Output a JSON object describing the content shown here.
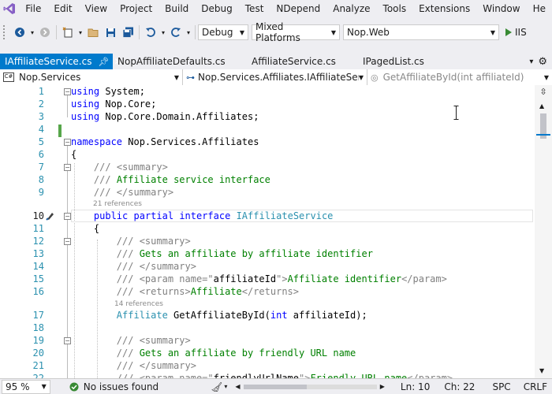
{
  "menu": {
    "items": [
      "File",
      "Edit",
      "View",
      "Project",
      "Build",
      "Debug",
      "Test",
      "NDepend",
      "Analyze",
      "Tools",
      "Extensions",
      "Window",
      "He"
    ]
  },
  "toolbar": {
    "config": "Debug",
    "platform": "Mixed Platforms",
    "startup_project": "Nop.Web",
    "run_label": "IIS"
  },
  "tabs": [
    {
      "label": "IAffiliateService.cs",
      "active": true
    },
    {
      "label": "NopAffiliateDefaults.cs",
      "active": false
    },
    {
      "label": "AffiliateService.cs",
      "active": false
    },
    {
      "label": "IPagedList.cs",
      "active": false
    }
  ],
  "nav": {
    "project": "Nop.Services",
    "type": "Nop.Services.Affiliates.IAffiliateServic",
    "member": "GetAffiliateById(int affiliateId)"
  },
  "code": {
    "lines": [
      {
        "n": "1",
        "text": "using System;"
      },
      {
        "n": "2",
        "text": "using Nop.Core;"
      },
      {
        "n": "3",
        "text": "using Nop.Core.Domain.Affiliates;"
      },
      {
        "n": "4",
        "text": ""
      },
      {
        "n": "5",
        "text": "namespace Nop.Services.Affiliates"
      },
      {
        "n": "6",
        "text": "{"
      },
      {
        "n": "7",
        "text": "    /// <summary>"
      },
      {
        "n": "8",
        "text": "    /// Affiliate service interface"
      },
      {
        "n": "9",
        "text": "    /// </summary>"
      },
      {
        "n": "10",
        "text": "    public partial interface IAffiliateService"
      },
      {
        "n": "11",
        "text": "    {"
      },
      {
        "n": "12",
        "text": "        /// <summary>"
      },
      {
        "n": "13",
        "text": "        /// Gets an affiliate by affiliate identifier"
      },
      {
        "n": "14",
        "text": "        /// </summary>"
      },
      {
        "n": "15",
        "text": "        /// <param name=\"affiliateId\">Affiliate identifier</param>"
      },
      {
        "n": "16",
        "text": "        /// <returns>Affiliate</returns>"
      },
      {
        "n": "17",
        "text": "        Affiliate GetAffiliateById(int affiliateId);"
      },
      {
        "n": "18",
        "text": ""
      },
      {
        "n": "19",
        "text": "        /// <summary>"
      },
      {
        "n": "20",
        "text": "        /// Gets an affiliate by friendly URL name"
      },
      {
        "n": "21",
        "text": "        /// </summary>"
      },
      {
        "n": "22",
        "text": "        /// <param name=\"friendlyUrlName\">Friendly URL name</param>"
      }
    ],
    "refs_interface": "21 references",
    "refs_method": "14 references"
  },
  "status": {
    "zoom": "95 %",
    "issues": "No issues found",
    "line": "Ln: 10",
    "col": "Ch: 22",
    "spacing": "SPC",
    "line_ending": "CRLF"
  },
  "colors": {
    "accent": "#007acc",
    "keyword": "#0000ff",
    "type": "#2b91af",
    "comment": "#008000",
    "ok": "#388a34"
  }
}
